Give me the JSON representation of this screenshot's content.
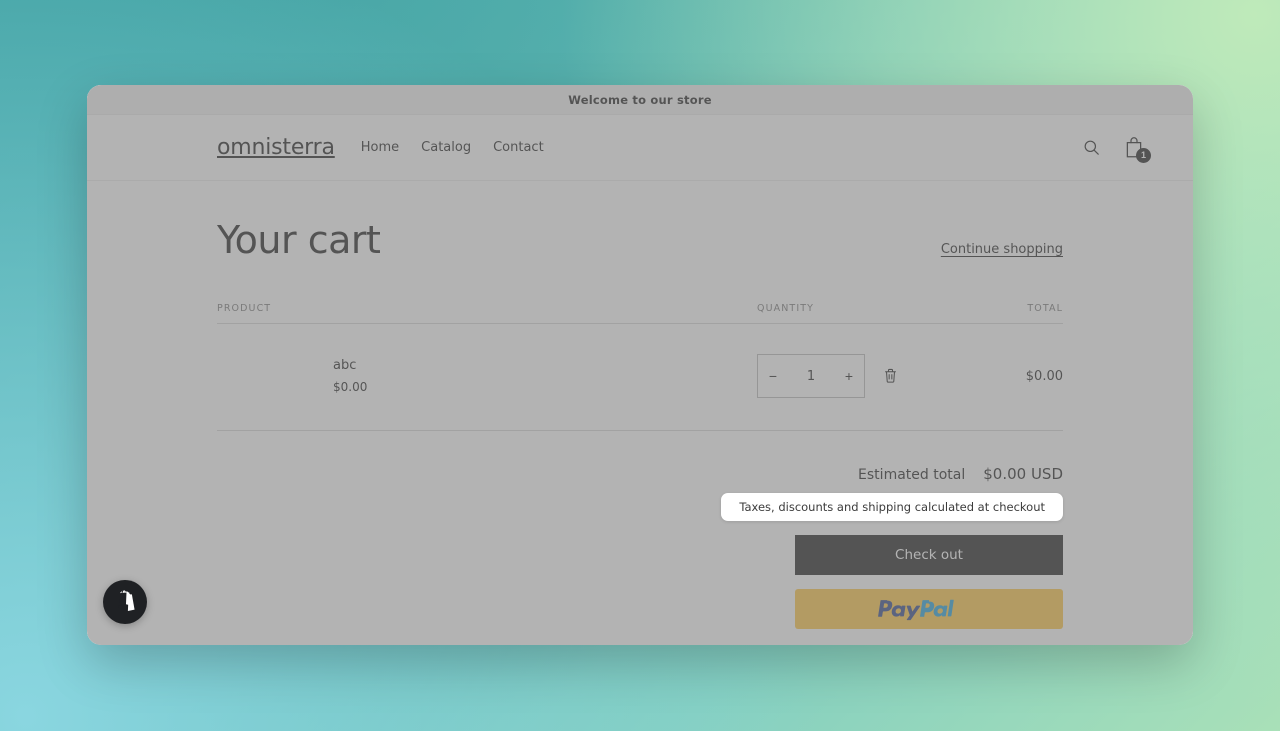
{
  "announcement": {
    "text": "Welcome to our store"
  },
  "header": {
    "brand": "omnisterra",
    "nav": [
      {
        "label": "Home"
      },
      {
        "label": "Catalog"
      },
      {
        "label": "Contact"
      }
    ],
    "search_icon": "search-icon",
    "cart_icon": "cart-icon",
    "cart_count": "1"
  },
  "cart": {
    "title": "Your cart",
    "continue_shopping": "Continue shopping",
    "columns": {
      "product": "PRODUCT",
      "quantity": "QUANTITY",
      "total": "TOTAL"
    },
    "items": [
      {
        "name": "abc",
        "price": "$0.00",
        "quantity": "1",
        "decrease_label": "−",
        "increase_label": "+",
        "remove_icon": "trash-icon",
        "line_total": "$0.00"
      }
    ],
    "totals": {
      "label": "Estimated total",
      "value": "$0.00 USD",
      "note": "Taxes, discounts and shipping calculated at checkout"
    },
    "checkout_label": "Check out",
    "paypal_label": "PayPal"
  },
  "chat_widget": {
    "icon": "shopify-bag-icon"
  },
  "colors": {
    "accent_dark": "#121212",
    "paypal_yellow": "#ffc439",
    "paypal_blue_dark": "#253b80",
    "paypal_blue_light": "#179bd7",
    "border": "#d4d4d4",
    "muted_text": "#717171"
  }
}
